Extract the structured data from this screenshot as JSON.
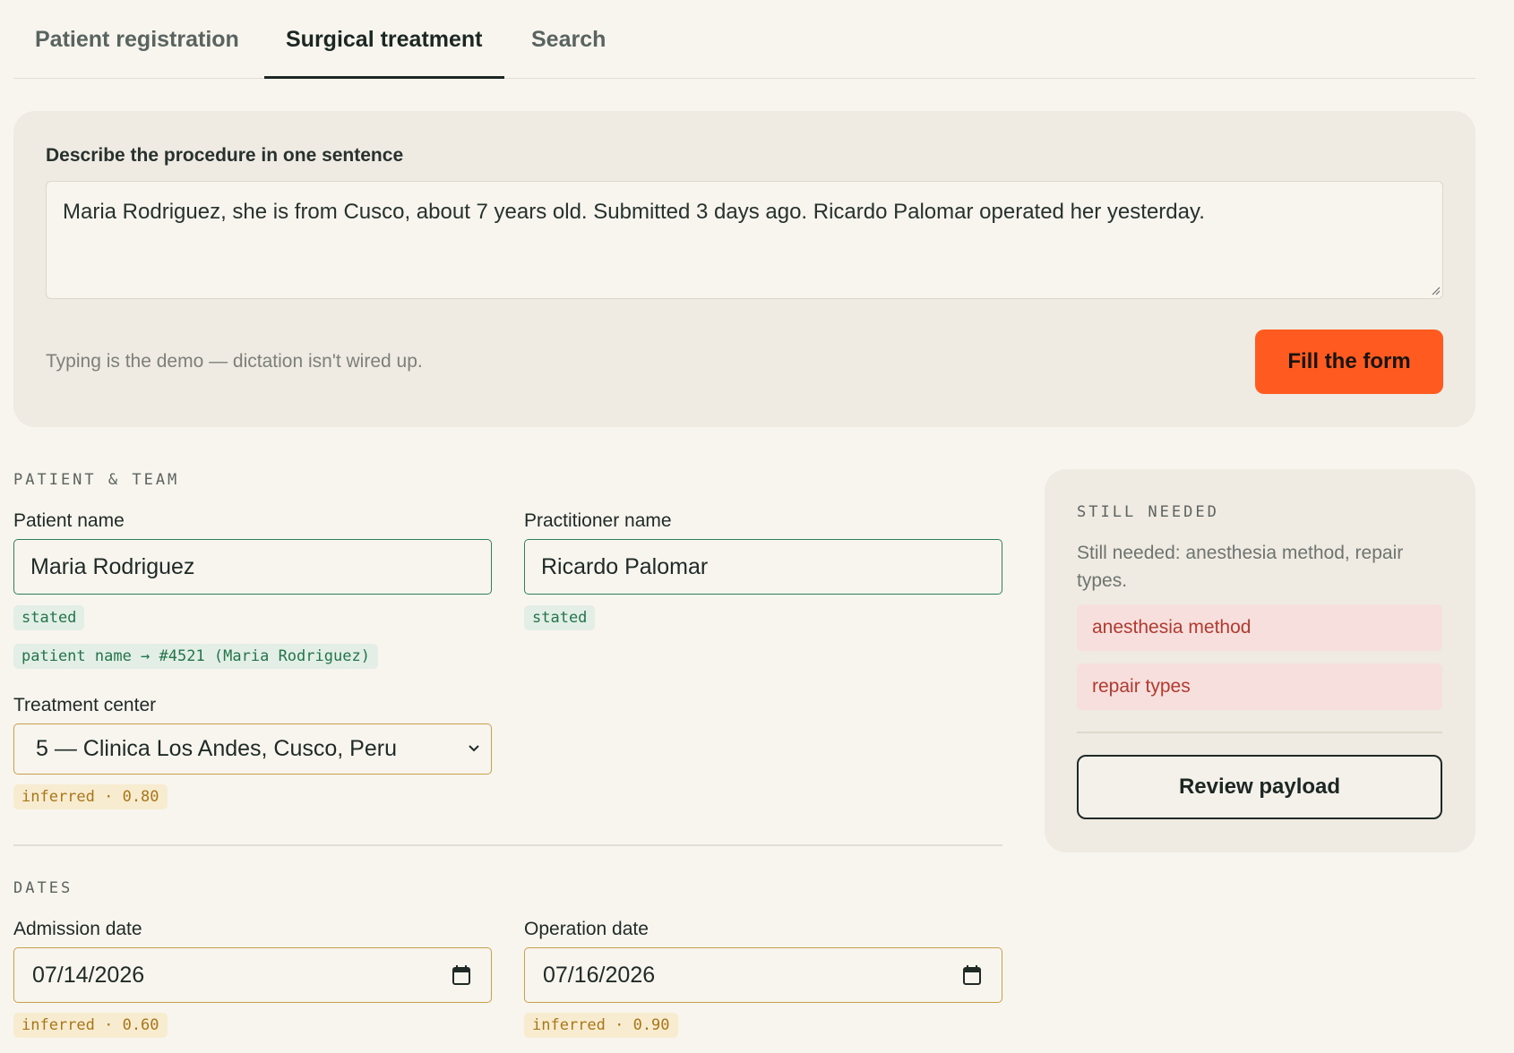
{
  "tabs": [
    {
      "label": "Patient registration",
      "active": false
    },
    {
      "label": "Surgical treatment",
      "active": true
    },
    {
      "label": "Search",
      "active": false
    }
  ],
  "describe": {
    "label": "Describe the procedure in one sentence",
    "text": "Maria Rodriguez, she is from Cusco, about 7 years old. Submitted 3 days ago. Ricardo Palomar operated her yesterday.",
    "hint": "Typing is the demo — dictation isn't wired up.",
    "fill_button": "Fill the form"
  },
  "patient_team": {
    "heading": "PATIENT & TEAM",
    "patient_name": {
      "label": "Patient name",
      "value": "Maria Rodriguez",
      "badge": "stated",
      "match": "patient name → #4521 (Maria Rodriguez)"
    },
    "practitioner_name": {
      "label": "Practitioner name",
      "value": "Ricardo Palomar",
      "badge": "stated"
    },
    "treatment_center": {
      "label": "Treatment center",
      "value": "5 — Clinica Los Andes, Cusco, Peru",
      "badge": "inferred · 0.80"
    }
  },
  "dates": {
    "heading": "DATES",
    "admission": {
      "label": "Admission date",
      "value": "07/14/2026",
      "badge": "inferred · 0.60"
    },
    "operation": {
      "label": "Operation date",
      "value": "07/16/2026",
      "badge": "inferred · 0.90"
    }
  },
  "still_needed": {
    "heading": "STILL NEEDED",
    "summary": "Still needed: anesthesia method, repair types.",
    "items": [
      "anesthesia method",
      "repair types"
    ],
    "review_button": "Review payload"
  },
  "colors": {
    "accent": "#ff5a1f",
    "stated": "#23744a",
    "inferred": "#a8761a",
    "missing": "#b23a30"
  }
}
